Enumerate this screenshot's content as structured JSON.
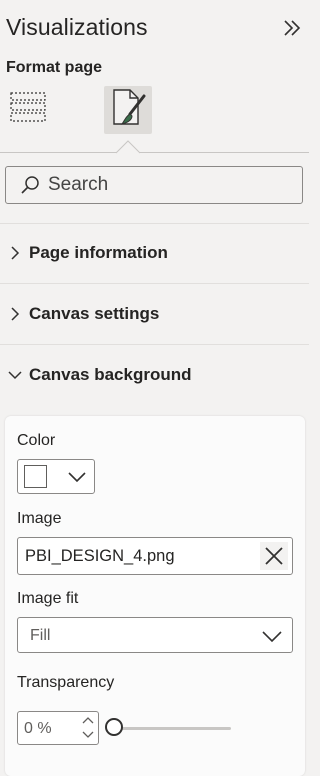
{
  "pane": {
    "title": "Visualizations",
    "subtitle": "Format page"
  },
  "search": {
    "placeholder": "Search"
  },
  "sections": [
    {
      "label": "Page information",
      "expanded": false
    },
    {
      "label": "Canvas settings",
      "expanded": false
    },
    {
      "label": "Canvas background",
      "expanded": true
    }
  ],
  "canvas_background": {
    "color_label": "Color",
    "color_value": "#ffffff",
    "image_label": "Image",
    "image_value": "PBI_DESIGN_4.png",
    "image_fit_label": "Image fit",
    "image_fit_value": "Fill",
    "transparency_label": "Transparency",
    "transparency_value": "0 %",
    "transparency_level": 0
  },
  "icons": {
    "collapse": "double-chevron-right-icon",
    "build_tab": "build-visual-icon",
    "format_tab": "format-paintbrush-icon",
    "search": "search-icon",
    "clear": "close-icon"
  }
}
